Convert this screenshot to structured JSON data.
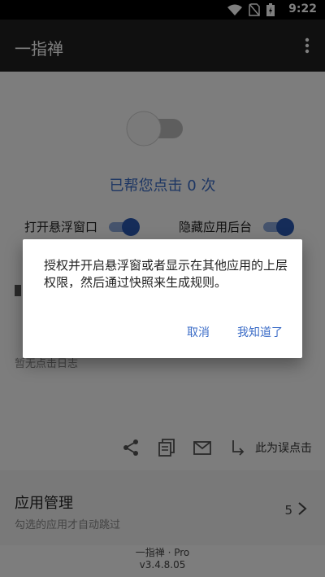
{
  "status_bar": {
    "time": "9:22"
  },
  "app_bar": {
    "title": "一指禅"
  },
  "main": {
    "count_text": "已帮您点击 0 次",
    "toggles": [
      {
        "label": "打开悬浮窗口"
      },
      {
        "label": "隐藏应用后台"
      }
    ],
    "log_label": "暂无点击日志",
    "mark_misclick": "此为误点击"
  },
  "app_section": {
    "title": "应用管理",
    "subtitle": "勾选的应用才自动跳过",
    "count": "5"
  },
  "footer": {
    "app_name": "一指禅 · Pro",
    "version": "v3.4.8.05"
  },
  "dialog": {
    "message": "授权并开启悬浮窗或者显示在其他应用的上层权限，然后通过快照来生成规则。",
    "cancel": "取消",
    "confirm": "我知道了"
  },
  "colors": {
    "accent": "#3b6cc7",
    "app_bar": "#212121",
    "switch_on": "#2a59b3"
  }
}
